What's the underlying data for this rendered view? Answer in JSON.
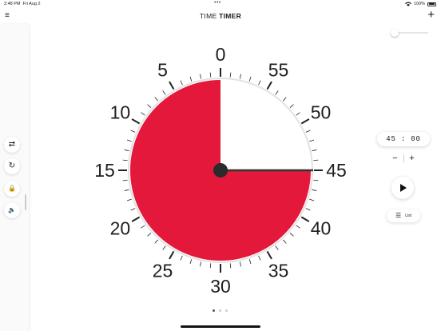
{
  "status_bar": {
    "time": "2:48 PM",
    "date": "Fri Aug 2",
    "battery": "100%",
    "dots": "•••",
    "wifi_icon": "wifi-icon",
    "battery_icon": "battery-icon"
  },
  "header": {
    "title_light": "TIME ",
    "title_bold": "TIMER",
    "menu_icon": "≡",
    "add_icon": "+"
  },
  "sidebar": {
    "buttons": [
      {
        "icon": "⇄",
        "name": "repeat"
      },
      {
        "icon": "↻",
        "name": "reset"
      },
      {
        "icon": "🔒",
        "name": "lock"
      },
      {
        "icon": "🔈",
        "name": "sound"
      }
    ]
  },
  "timer": {
    "minutes_remaining": 45,
    "total_minutes": 60,
    "display": "45 : 00",
    "color": "#e3183a",
    "labels": [
      "0",
      "5",
      "10",
      "15",
      "20",
      "25",
      "30",
      "35",
      "40",
      "45",
      "50",
      "55"
    ]
  },
  "controls": {
    "minus": "−",
    "plus": "+",
    "list_icon": "☰",
    "list_label": "List"
  },
  "pager": {
    "count": 3,
    "active": 0
  }
}
